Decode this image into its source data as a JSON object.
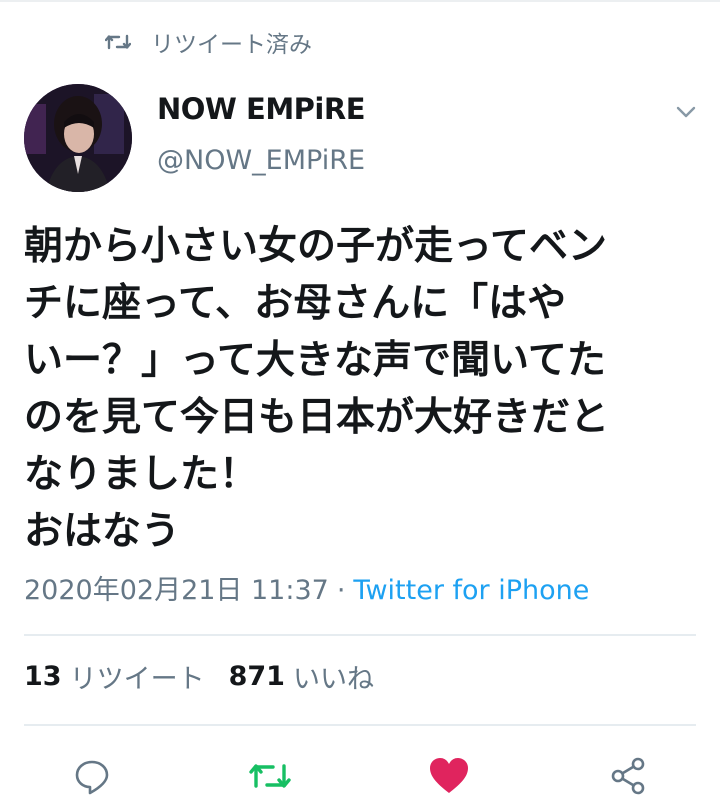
{
  "retweeted_label": "リツイート済み",
  "author": {
    "display_name": "NOW EMPiRE",
    "handle": "@NOW_EMPiRE"
  },
  "tweet": {
    "text": "朝から小さい女の子が走ってベン\nチに座って、お母さんに「はや\nいー？」って大きな声で聞いてた\nのを見て今日も日本が大好きだと\nなりました！\nおはなう",
    "timestamp": "2020年02月21日 11:37",
    "separator": "·",
    "source": "Twitter for iPhone"
  },
  "stats": {
    "retweets_count": "13",
    "retweets_label": "リツイート",
    "likes_count": "871",
    "likes_label": "いいね"
  },
  "icons": {
    "retweeted": "retweet-icon",
    "menu": "chevron-down-icon",
    "reply": "reply-icon",
    "retweet": "retweet-icon",
    "like": "heart-icon",
    "share": "share-icon"
  },
  "colors": {
    "text_primary": "#14171a",
    "text_secondary": "#657786",
    "link_blue": "#1da1f2",
    "retweet_green": "#17bf63",
    "like_red": "#e0245e"
  }
}
